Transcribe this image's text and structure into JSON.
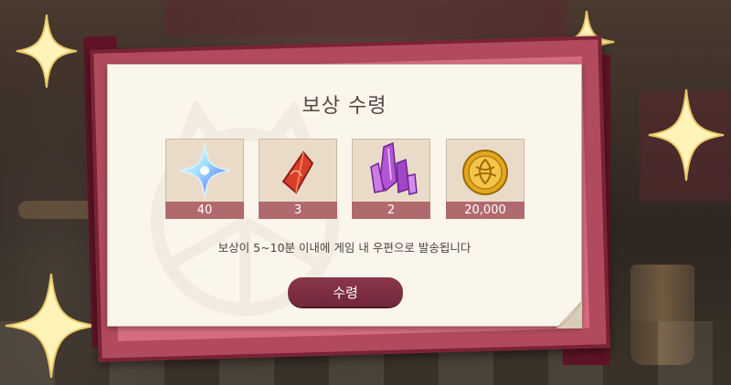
{
  "dialog": {
    "title": "보상 수령",
    "notice": "보상이 5~10분 이내에 게임 내 우편으로 발송됩니다",
    "button_label": "수령"
  },
  "rewards": [
    {
      "icon": "star-crystal-icon",
      "quantity": "40"
    },
    {
      "icon": "red-gem-shard-icon",
      "quantity": "3"
    },
    {
      "icon": "purple-crystal-cluster-icon",
      "quantity": "2"
    },
    {
      "icon": "gold-coin-icon",
      "quantity": "20,000"
    }
  ],
  "colors": {
    "button": "#7c2d40",
    "quantity_bar": "#b06a6e",
    "paper": "#fbf6ec",
    "card_back": "#b14a5d",
    "sparkle": "#fff4b8"
  }
}
